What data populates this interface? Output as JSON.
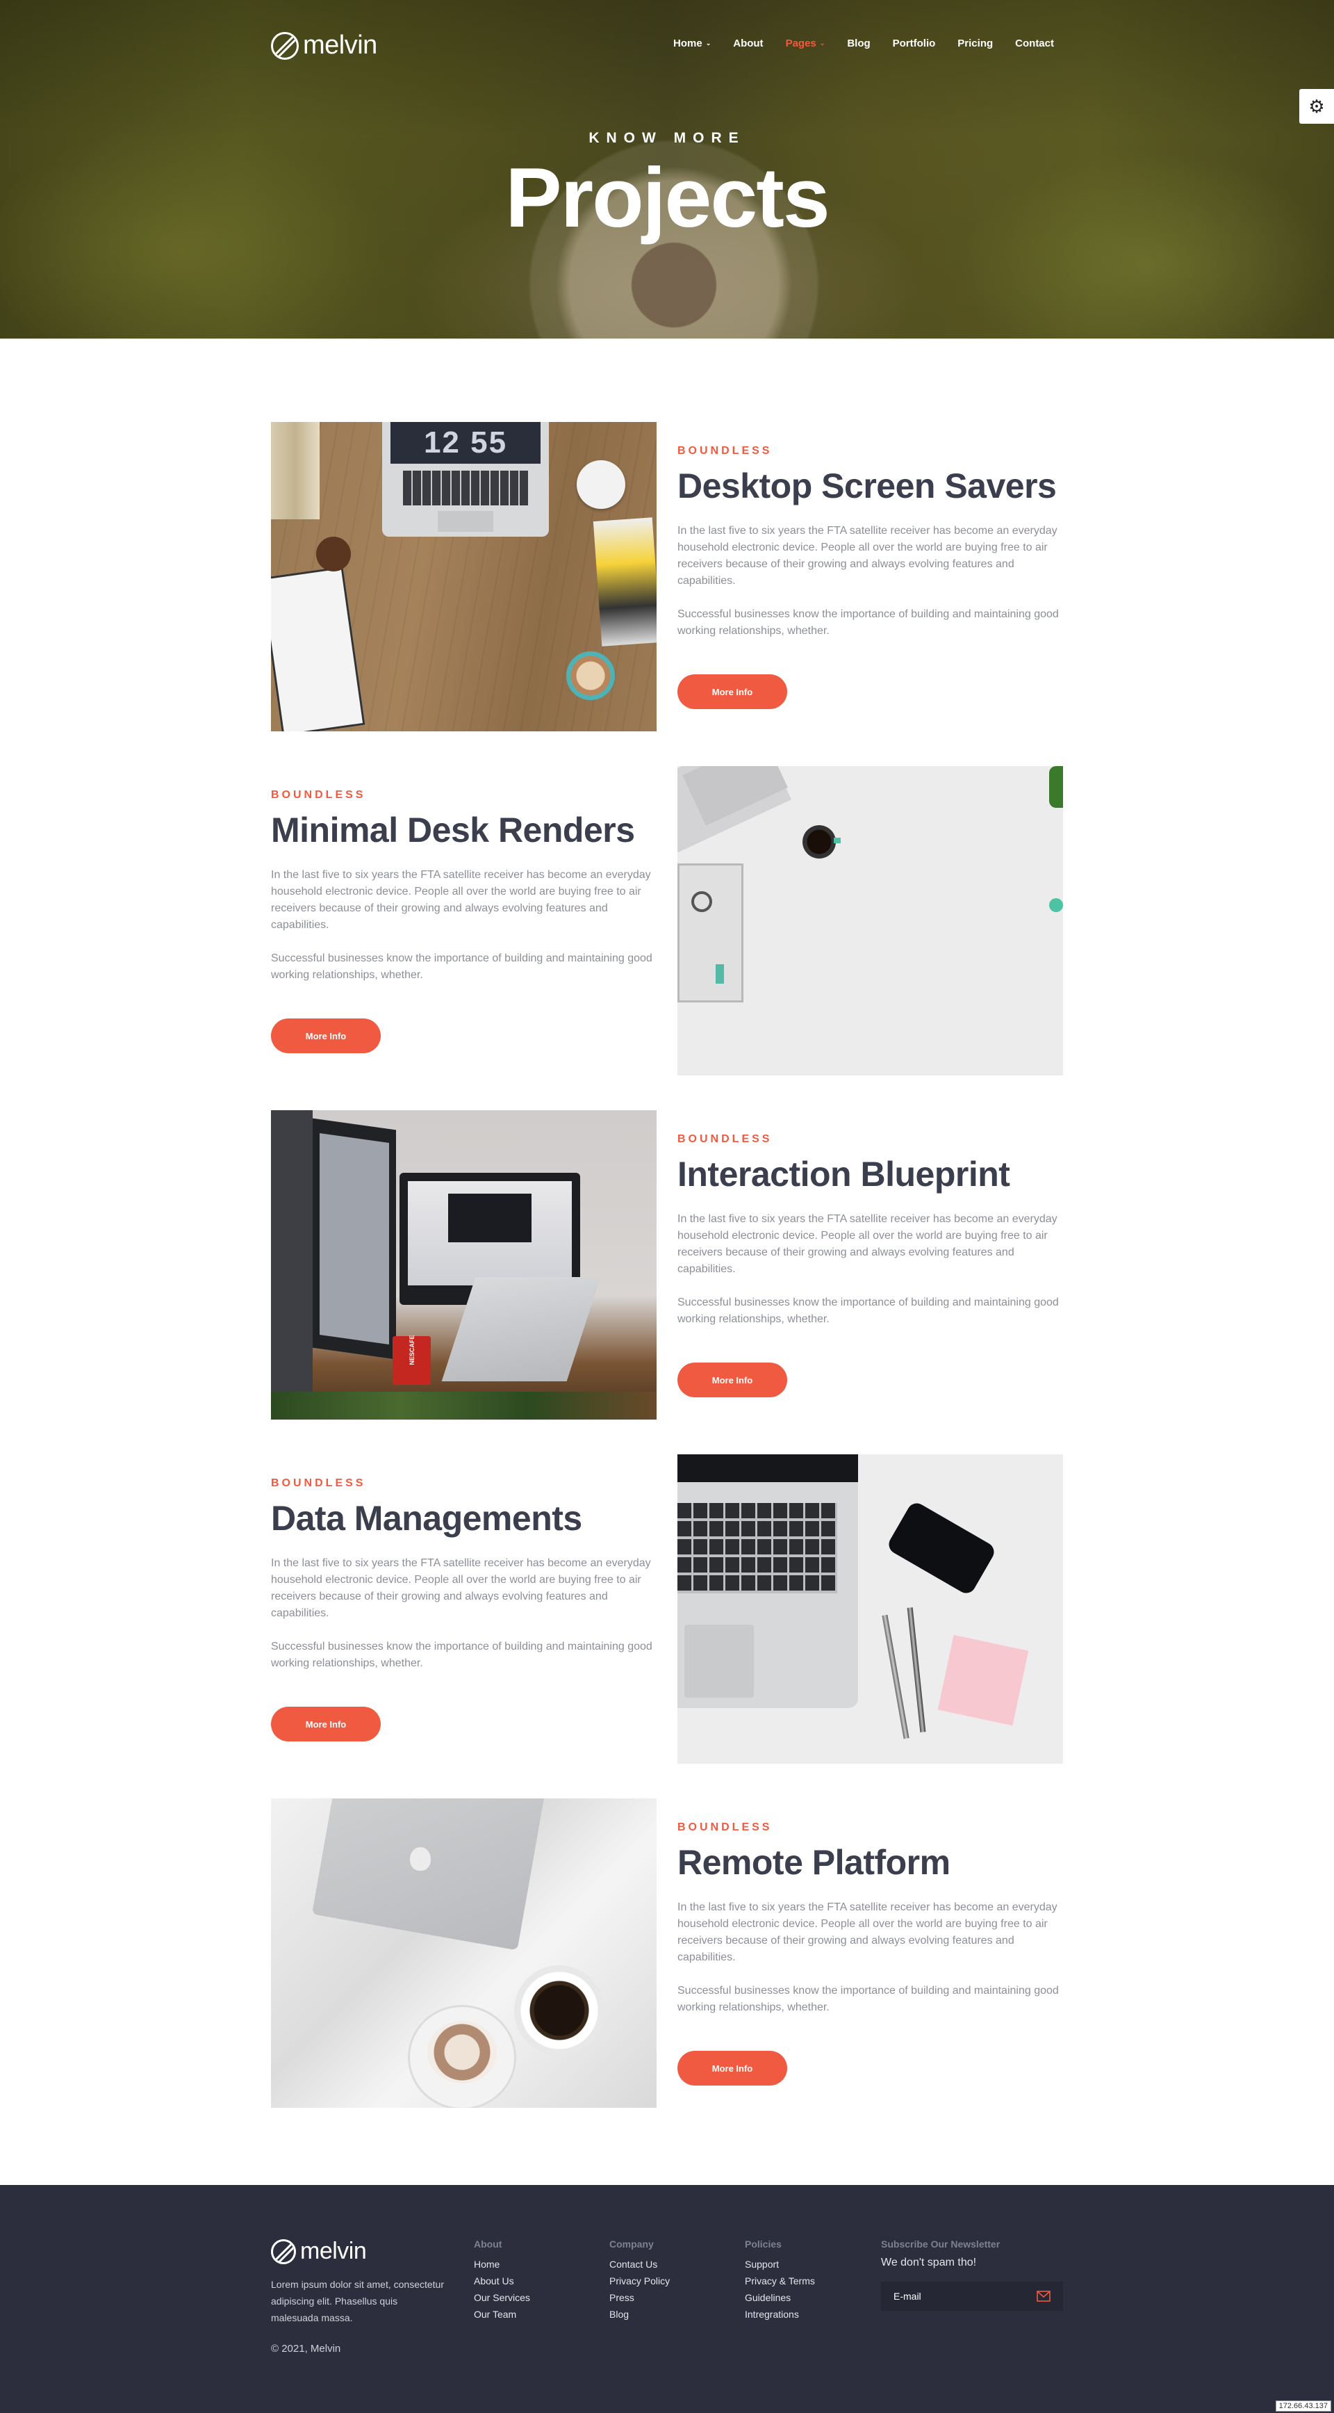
{
  "brand": {
    "name": "melvin"
  },
  "nav": {
    "items": [
      {
        "label": "Home",
        "has_caret": true,
        "active": false
      },
      {
        "label": "About",
        "has_caret": false,
        "active": false
      },
      {
        "label": "Pages",
        "has_caret": true,
        "active": true
      },
      {
        "label": "Blog",
        "has_caret": false,
        "active": false
      },
      {
        "label": "Portfolio",
        "has_caret": false,
        "active": false
      },
      {
        "label": "Pricing",
        "has_caret": false,
        "active": false
      },
      {
        "label": "Contact",
        "has_caret": false,
        "active": false
      }
    ],
    "caret_glyph": "⌄",
    "settings_icon": "gear-icon"
  },
  "hero": {
    "kicker": "KNOW MORE",
    "title": "Projects"
  },
  "projects": [
    {
      "tag": "BOUNDLESS",
      "title": "Desktop Screen Savers",
      "p1": "In the last five to six years the FTA satellite receiver has become an everyday household electronic device. People all over the world are buying free to air receivers because of their growing and always evolving features and capabilities.",
      "p2": "Successful businesses know the importance of building and maintaining good working relationships, whether.",
      "button": "More Info",
      "clock_text": "12 55"
    },
    {
      "tag": "BOUNDLESS",
      "title": "Minimal Desk Renders",
      "p1": "In the last five to six years the FTA satellite receiver has become an everyday household electronic device. People all over the world are buying free to air receivers because of their growing and always evolving features and capabilities.",
      "p2": "Successful businesses know the importance of building and maintaining good working relationships, whether.",
      "button": "More Info"
    },
    {
      "tag": "BOUNDLESS",
      "title": "Interaction Blueprint",
      "p1": "In the last five to six years the FTA satellite receiver has become an everyday household electronic device. People all over the world are buying free to air receivers because of their growing and always evolving features and capabilities.",
      "p2": "Successful businesses know the importance of building and maintaining good working relationships, whether.",
      "button": "More Info",
      "mug_text": "NESCAFE"
    },
    {
      "tag": "BOUNDLESS",
      "title": "Data Managements",
      "p1": "In the last five to six years the FTA satellite receiver has become an everyday household electronic device. People all over the world are buying free to air receivers because of their growing and always evolving features and capabilities.",
      "p2": "Successful businesses know the importance of building and maintaining good working relationships, whether.",
      "button": "More Info"
    },
    {
      "tag": "BOUNDLESS",
      "title": "Remote Platform",
      "p1": "In the last five to six years the FTA satellite receiver has become an everyday household electronic device. People all over the world are buying free to air receivers because of their growing and always evolving features and capabilities.",
      "p2": "Successful businesses know the importance of building and maintaining good working relationships, whether.",
      "button": "More Info"
    }
  ],
  "footer": {
    "description": "Lorem ipsum dolor sit amet, consectetur adipiscing elit. Phasellus quis malesuada massa.",
    "copyright": "© 2021, Melvin",
    "columns": [
      {
        "title": "About",
        "links": [
          "Home",
          "About Us",
          "Our Services",
          "Our Team"
        ]
      },
      {
        "title": "Company",
        "links": [
          "Contact Us",
          "Privacy Policy",
          "Press",
          "Blog"
        ]
      },
      {
        "title": "Policies",
        "links": [
          "Support",
          "Privacy & Terms",
          "Guidelines",
          "Intregrations"
        ]
      }
    ],
    "newsletter": {
      "title": "Subscribe Our Newsletter",
      "subtitle": "We don't spam tho!",
      "placeholder": "E-mail",
      "icon": "envelope-icon"
    }
  },
  "ip_badge": "172.66.43.137",
  "colors": {
    "accent": "#f05a40",
    "heading": "#3b3e4d",
    "footer_bg": "#2c2e3d"
  }
}
